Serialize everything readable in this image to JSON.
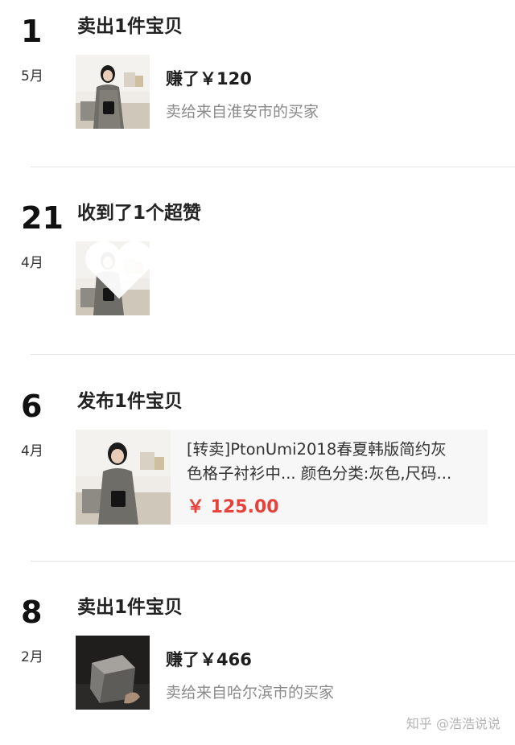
{
  "feed": [
    {
      "day": "1",
      "month": "5月",
      "title": "卖出1件宝贝",
      "earned": "赚了￥120",
      "buyer": "卖给来自淮安市的买家"
    },
    {
      "day": "21",
      "month": "4月",
      "title": "收到了1个超赞"
    },
    {
      "day": "6",
      "month": "4月",
      "title": "发布1件宝贝",
      "desc_line1": "[转卖]PtonUmi2018春夏韩版简约灰",
      "desc_line2": "色格子衬衫中... 颜色分类:灰色,尺码...",
      "price": "￥ 125.00"
    },
    {
      "day": "8",
      "month": "2月",
      "title": "卖出1件宝贝",
      "earned": "赚了￥466",
      "buyer": "卖给来自哈尔滨市的买家"
    }
  ],
  "watermark": "知乎 @浩浩说说",
  "colors": {
    "price": "#e6413a",
    "muted": "#8a8a8a",
    "divider": "#e4e4e4"
  }
}
